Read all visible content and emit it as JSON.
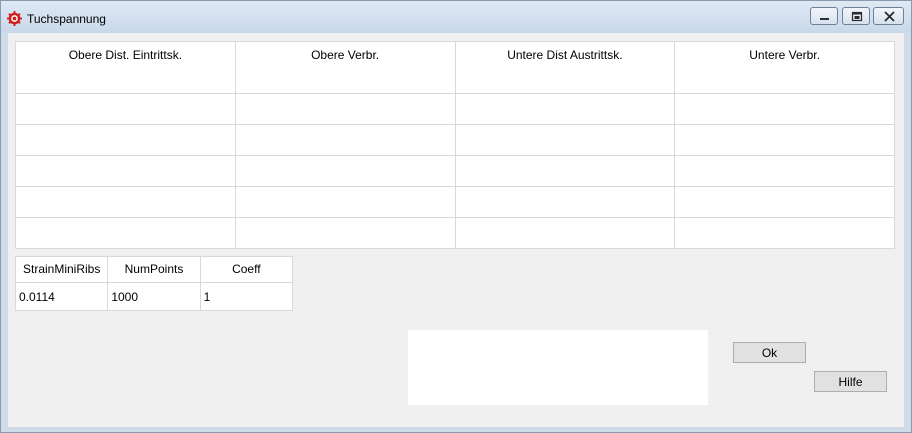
{
  "window": {
    "title": "Tuchspannung",
    "icon": "gear-icon",
    "controls": [
      "minimize-icon",
      "restore-icon",
      "close-icon"
    ]
  },
  "main_table": {
    "columns": [
      "Obere Dist. Eintrittsk.",
      "Obere Verbr.",
      "Untere Dist Austrittsk.",
      "Untere Verbr."
    ],
    "rows": [
      [
        "",
        "",
        "",
        ""
      ],
      [
        "",
        "",
        "",
        ""
      ],
      [
        "",
        "",
        "",
        ""
      ],
      [
        "",
        "",
        "",
        ""
      ],
      [
        "",
        "",
        "",
        ""
      ]
    ]
  },
  "params_table": {
    "columns": [
      "StrainMiniRibs",
      "NumPoints",
      "Coeff"
    ],
    "rows": [
      [
        "0.0114",
        "1000",
        "1"
      ]
    ]
  },
  "buttons": {
    "ok": "Ok",
    "help": "Hilfe"
  },
  "colors": {
    "icon_red": "#cc1f1f",
    "client_bg": "#f0f0f0",
    "grid_border": "#828790"
  }
}
